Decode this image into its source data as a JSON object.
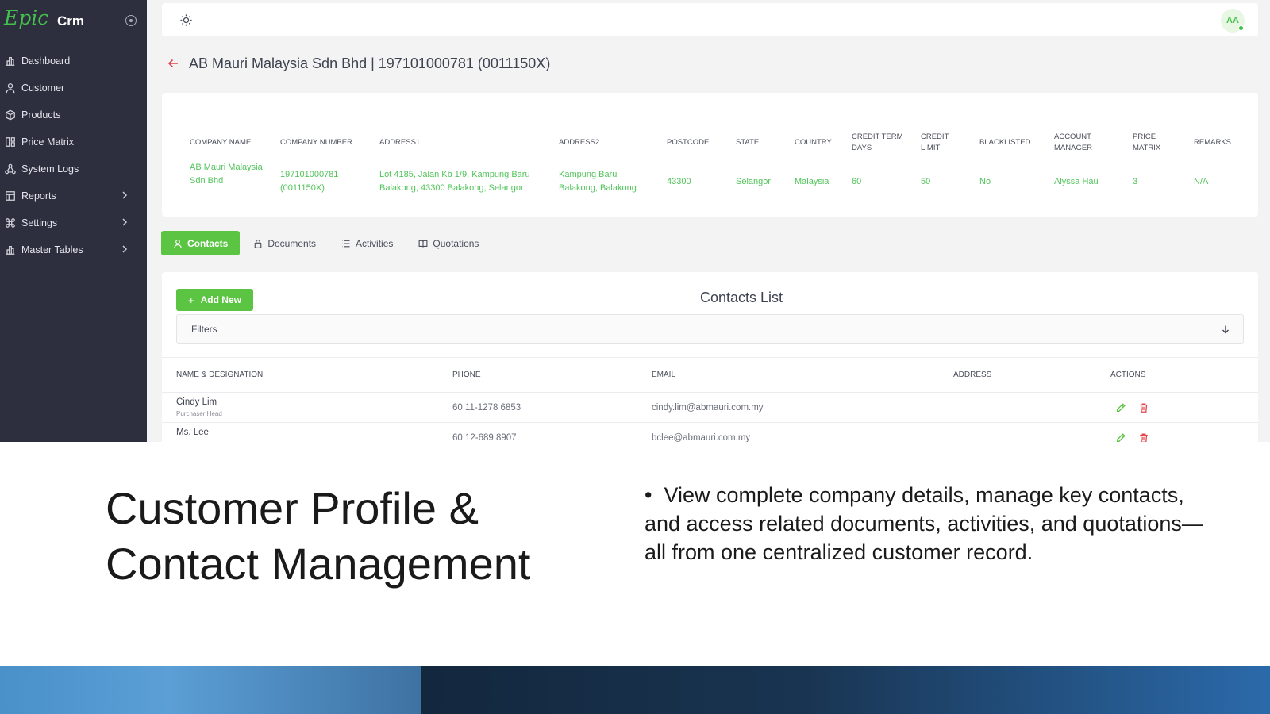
{
  "sidebar": {
    "logo": "Epic",
    "app_name": "Crm",
    "items": [
      {
        "label": "Dashboard",
        "icon": "chart-bar-icon"
      },
      {
        "label": "Customer",
        "icon": "user-icon"
      },
      {
        "label": "Products",
        "icon": "box-icon"
      },
      {
        "label": "Price Matrix",
        "icon": "grid-icon"
      },
      {
        "label": "System Logs",
        "icon": "network-icon"
      },
      {
        "label": "Reports",
        "icon": "table-icon",
        "has_submenu": true
      },
      {
        "label": "Settings",
        "icon": "command-icon",
        "has_submenu": true
      },
      {
        "label": "Master Tables",
        "icon": "chart-bar-icon",
        "has_submenu": true
      }
    ]
  },
  "topbar": {
    "theme_icon": "sun-icon",
    "avatar_initials": "AA"
  },
  "page": {
    "title": "AB Mauri Malaysia Sdn Bhd | 197101000781 (0011150X)"
  },
  "company": {
    "headers": [
      "COMPANY NAME",
      "COMPANY NUMBER",
      "ADDRESS1",
      "ADDRESS2",
      "POSTCODE",
      "STATE",
      "COUNTRY",
      "CREDIT TERM DAYS",
      "CREDIT LIMIT",
      "BLACKLISTED",
      "ACCOUNT MANAGER",
      "PRICE MATRIX",
      "REMARKS"
    ],
    "row": {
      "company_name": "AB Mauri Malaysia Sdn Bhd",
      "company_number": "197101000781 (0011150X)",
      "address1": "Lot 4185, Jalan Kb 1/9, Kampung Baru Balakong, 43300 Balakong, Selangor",
      "address2": "Kampung Baru Balakong, Balakong",
      "postcode": "43300",
      "state": "Selangor",
      "country": "Malaysia",
      "credit_term_days": "60",
      "credit_limit": "50",
      "blacklisted": "No",
      "account_manager": "Alyssa Hau",
      "price_matrix": "3",
      "remarks": "N/A"
    }
  },
  "tabs": [
    {
      "label": "Contacts",
      "icon": "user-icon",
      "active": true
    },
    {
      "label": "Documents",
      "icon": "lock-icon",
      "active": false
    },
    {
      "label": "Activities",
      "icon": "list-icon",
      "active": false
    },
    {
      "label": "Quotations",
      "icon": "book-icon",
      "active": false
    }
  ],
  "contacts": {
    "add_label": "Add New",
    "title": "Contacts List",
    "filters_label": "Filters",
    "headers": [
      "NAME & DESIGNATION",
      "PHONE",
      "EMAIL",
      "ADDRESS",
      "ACTIONS"
    ],
    "rows": [
      {
        "name": "Cindy Lim",
        "designation": "Purchaser Head",
        "phone": "60 11-1278 6853",
        "email": "cindy.lim@abmauri.com.my",
        "address": ""
      },
      {
        "name": "Ms. Lee",
        "designation": "",
        "phone": "60 12-689 8907",
        "email": "bclee@abmauri.com.my",
        "address": ""
      }
    ]
  },
  "slide": {
    "heading_line1": "Customer Profile &",
    "heading_line2": "Contact Management",
    "bullet": "View complete company details, manage key contacts, and access related documents, activities, and quotations—all from one centralized customer record."
  },
  "colors": {
    "accent": "#5bc543",
    "sidebar_bg": "#2d2f3f",
    "danger": "#e0474c"
  }
}
